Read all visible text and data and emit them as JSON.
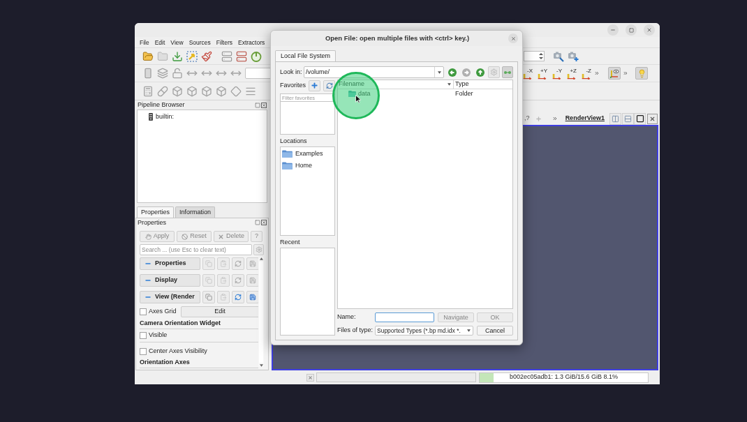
{
  "main_window": {
    "menu": [
      {
        "label": "File"
      },
      {
        "label": "Edit"
      },
      {
        "label": "View"
      },
      {
        "label": "Sources"
      },
      {
        "label": "Filters"
      },
      {
        "label": "Extractors"
      }
    ],
    "camera_toolbar": {
      "axes": [
        "-X",
        "+Y",
        "-Y",
        "+Z",
        "-Z"
      ],
      "toggles": [
        {
          "kind": "axes",
          "checked": true
        },
        {
          "kind": "light",
          "checked": true
        }
      ]
    },
    "pipeline_browser": {
      "title": "Pipeline Browser",
      "items": [
        {
          "label": "builtin:"
        }
      ]
    },
    "panel_tabs": [
      {
        "label": "Properties",
        "selected": true
      },
      {
        "label": "Information",
        "selected": false
      }
    ],
    "properties_panel": {
      "title": "Properties",
      "buttons": [
        {
          "kind": "apply",
          "label": "Apply",
          "disabled": true
        },
        {
          "kind": "reset",
          "label": "Reset",
          "disabled": true
        },
        {
          "kind": "delete",
          "label": "Delete",
          "disabled": true
        },
        {
          "kind": "help",
          "label": "?",
          "disabled": true
        }
      ],
      "search": {
        "placeholder": "Search ... (use Esc to clear text)"
      },
      "sections": [
        {
          "label": "Properties",
          "expanded": true,
          "actions_enabled": false
        },
        {
          "label": "Display",
          "expanded": true,
          "actions_enabled": false
        },
        {
          "label": "View (Render",
          "expanded": true,
          "actions_enabled": true
        }
      ],
      "rows": [
        {
          "kind": "checkbox",
          "label": "Axes Grid",
          "checked": false,
          "button": "Edit"
        },
        {
          "kind": "heading",
          "label": "Camera Orientation Widget"
        },
        {
          "kind": "checkbox",
          "label": "Visible",
          "checked": false
        },
        {
          "kind": "checkbox",
          "label": "Center Axes Visibility",
          "checked": false
        },
        {
          "kind": "heading",
          "label": "Orientation Axes"
        }
      ]
    },
    "view_toolbar": {
      "partial_text": ",?",
      "view_name": "RenderView1",
      "active": true
    },
    "status_bar": {
      "progress": {
        "level": 0
      },
      "memory": {
        "label": "b002ec05adb1: 1.3 GiB/15.6 GiB 8.1%",
        "level": 0.081
      }
    }
  },
  "dialog": {
    "title": "Open File: open multiple files with <ctrl> key.)",
    "tabs": [
      {
        "label": "Local File System",
        "selected": true
      }
    ],
    "look_in": {
      "label": "Look in:",
      "value": "/volume/"
    },
    "nav_buttons": [
      {
        "kind": "back",
        "disabled": false
      },
      {
        "kind": "forward",
        "disabled": true
      },
      {
        "kind": "up",
        "disabled": false
      },
      {
        "kind": "settings",
        "disabled": true
      },
      {
        "kind": "toggle",
        "checked": true
      }
    ],
    "favorites": {
      "label": "Favorites",
      "filter_placeholder": "Filter favorites"
    },
    "locations": {
      "label": "Locations",
      "items": [
        {
          "label": "Examples"
        },
        {
          "label": "Home"
        }
      ]
    },
    "recent": {
      "label": "Recent"
    },
    "files": {
      "columns": [
        "Filename",
        "Type"
      ],
      "rows": [
        {
          "kind": "folder",
          "name": "data",
          "type": "Folder"
        }
      ]
    },
    "name": {
      "label": "Name:",
      "focused": true
    },
    "name_buttons": [
      {
        "label": "Navigate",
        "disabled": true
      },
      {
        "label": "OK",
        "disabled": true
      }
    ],
    "files_of_type": {
      "label": "Files of type:",
      "value": "Supported Types (*.bp md.idx *."
    },
    "cancel": {
      "label": "Cancel",
      "disabled": false
    }
  },
  "click_highlight": {
    "visible": true
  }
}
